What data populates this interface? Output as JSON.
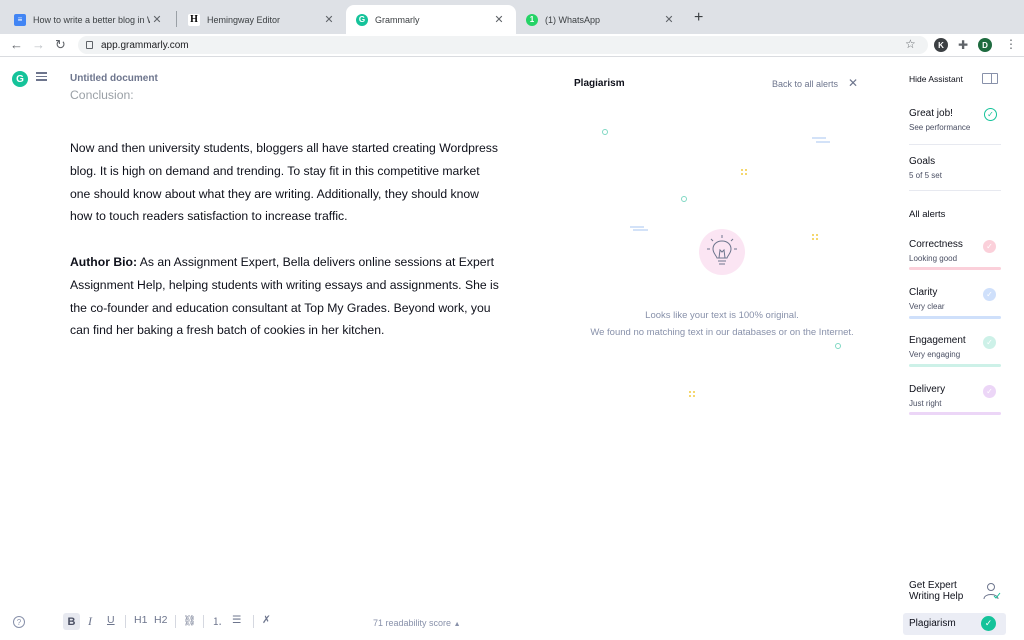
{
  "browser": {
    "tabs": [
      {
        "title": "How to write a better blog in W",
        "icon": "google-docs-icon"
      },
      {
        "title": "Hemingway Editor",
        "icon": "hemingway-icon"
      },
      {
        "title": "Grammarly",
        "icon": "grammarly-icon",
        "active": true
      },
      {
        "title": "(1) WhatsApp",
        "icon": "whatsapp-icon"
      }
    ],
    "close_glyph": "✕",
    "new_tab_glyph": "+",
    "url": "app.grammarly.com",
    "ext_k": "K",
    "profile_initial": "D"
  },
  "editor": {
    "doc_title": "Untitled document",
    "faded_heading": "Conclusion:",
    "paragraph1": "Now and then university students, bloggers all have started creating Wordpress blog. It is high on demand and trending. To stay fit in this competitive market one should know about what they are writing. Additionally, they should know how to touch readers satisfaction to increase traffic.",
    "bio_label": "Author Bio:",
    "bio_text": " As an Assignment Expert, Bella delivers online sessions at Expert Assignment Help, helping students with writing essays and assignments. She is the co-founder and education consultant at Top My Grades. Beyond work, you can find her baking a fresh batch of cookies in her kitchen."
  },
  "plagiarism": {
    "title": "Plagiarism",
    "back_label": "Back to all alerts",
    "message1": "Looks like your text is 100% original.",
    "message2": "We found no matching text in our databases or on the Internet."
  },
  "sidebar": {
    "hide_assistant": "Hide Assistant",
    "great_job": "Great job!",
    "see_performance": "See performance",
    "goals": "Goals",
    "goals_sub": "5 of 5 set",
    "all_alerts": "All alerts",
    "categories": [
      {
        "name": "Correctness",
        "status": "Looking good",
        "color": "#f7a8b8"
      },
      {
        "name": "Clarity",
        "status": "Very clear",
        "color": "#a7c4f2"
      },
      {
        "name": "Engagement",
        "status": "Very engaging",
        "color": "#a3e4d7"
      },
      {
        "name": "Delivery",
        "status": "Just right",
        "color": "#dcb8f0"
      }
    ],
    "expert_line1": "Get Expert",
    "expert_line2": "Writing Help",
    "plagiarism": "Plagiarism"
  },
  "format_toolbar": {
    "bold": "B",
    "italic": "I",
    "underline": "U",
    "h1": "H1",
    "h2": "H2",
    "readability": "71 readability score"
  },
  "colors": {
    "grammarly_green": "#15c39a"
  }
}
